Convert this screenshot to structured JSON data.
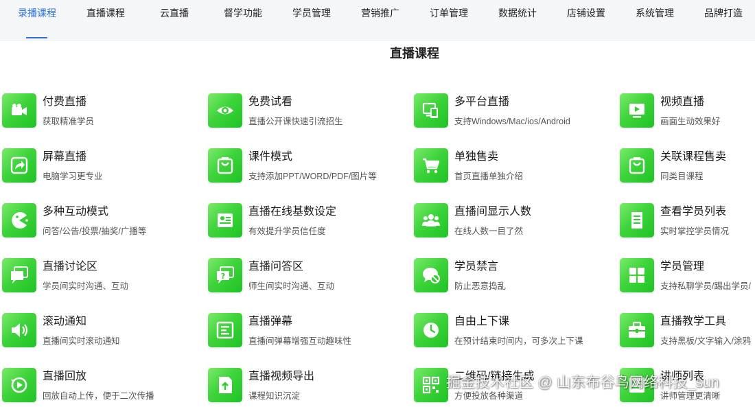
{
  "nav": {
    "tabs": [
      "录播课程",
      "直播课程",
      "云直播",
      "督学功能",
      "学员管理",
      "营销推广",
      "订单管理",
      "数据统计",
      "店铺设置",
      "系统管理",
      "品牌打造"
    ],
    "active_index": 0,
    "active_color": "#2a71d8"
  },
  "page": {
    "title": "直播课程"
  },
  "features": [
    {
      "title": "付费直播",
      "desc": "获取精准学员",
      "icon": "video-camera-icon"
    },
    {
      "title": "免费试看",
      "desc": "直播公开课快速引流招生",
      "icon": "eye-icon"
    },
    {
      "title": "多平台直播",
      "desc": "支持Windows/Mac/ios/Android",
      "icon": "devices-icon"
    },
    {
      "title": "视频直播",
      "desc": "画面生动效果好",
      "icon": "monitor-play-icon"
    },
    {
      "title": "屏幕直播",
      "desc": "电脑学习更专业",
      "icon": "share-arrow-icon"
    },
    {
      "title": "课件模式",
      "desc": "支持添加PPT/WORD/PDF/图片等",
      "icon": "shopping-bag-icon"
    },
    {
      "title": "单独售卖",
      "desc": "首页直播单独介绍",
      "icon": "cart-icon"
    },
    {
      "title": "关联课程售卖",
      "desc": "同类目课程",
      "icon": "shopping-bag-icon"
    },
    {
      "title": "多种互动模式",
      "desc": "问答/公告/投票/抽奖/广播等",
      "icon": "pacman-icon"
    },
    {
      "title": "直播在线基数设定",
      "desc": "有效提升学员信任度",
      "icon": "id-card-icon"
    },
    {
      "title": "直播间显示人数",
      "desc": "在线人数一目了然",
      "icon": "users-icon"
    },
    {
      "title": "查看学员列表",
      "desc": "实时掌控学员情况",
      "icon": "document-list-icon"
    },
    {
      "title": "直播讨论区",
      "desc": "学员间实时沟通、互动",
      "icon": "chat-bubbles-icon"
    },
    {
      "title": "直播问答区",
      "desc": "师生间实时沟通、互动",
      "icon": "question-bubble-icon"
    },
    {
      "title": "学员禁言",
      "desc": "防止恶意捣乱",
      "icon": "mute-chat-icon"
    },
    {
      "title": "学员管理",
      "desc": "支持私聊学员/踢出学员/",
      "icon": "grid-icon"
    },
    {
      "title": "滚动通知",
      "desc": "直播间实时滚动通知",
      "icon": "speaker-icon"
    },
    {
      "title": "直播弹幕",
      "desc": "直播间弹幕增强互动趣味性",
      "icon": "barrage-icon"
    },
    {
      "title": "自由上下课",
      "desc": "在预计结束时间内，可多次上下课",
      "icon": "clock-icon"
    },
    {
      "title": "直播教学工具",
      "desc": "支持黑板/文字输入/涂鸦",
      "icon": "toolbox-icon"
    },
    {
      "title": "直播回放",
      "desc": "回放自动上传，便于二次传播",
      "icon": "replay-icon"
    },
    {
      "title": "直播视频导出",
      "desc": "课程知识沉淀",
      "icon": "export-icon"
    },
    {
      "title": "二维码/链接生成",
      "desc": "方便投放各种渠道",
      "icon": "qrcode-icon"
    },
    {
      "title": "讲师列表",
      "desc": "讲师管理更清晰",
      "icon": "teacher-list-icon"
    }
  ],
  "watermark": "掘金技术社区 @ 山东布谷鸟网络科技_sun"
}
